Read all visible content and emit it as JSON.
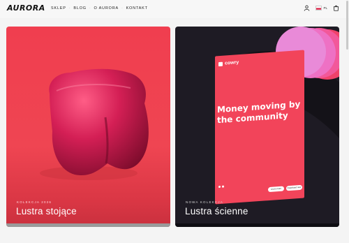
{
  "header": {
    "logo": "AURORA",
    "nav": [
      {
        "label": "SKLEP"
      },
      {
        "label": "BLOG"
      },
      {
        "label": "O AURORA"
      },
      {
        "label": "KONTAKT"
      }
    ],
    "language": "PL",
    "icons": [
      "user-icon",
      "flag-pl-icon",
      "cart-icon"
    ]
  },
  "cards": [
    {
      "tag": "KOLEKCJA 2026",
      "title": "Lustra stojące",
      "background": "#ef4552"
    },
    {
      "tag": "NOWA KOLEKCJA",
      "title": "Lustra ścienne",
      "background": "#1e1b24",
      "poster": {
        "brand": "cowry",
        "headline": "Money moving by the community",
        "buttons": [
          "Learn more",
          "Download now"
        ]
      }
    }
  ],
  "colors": {
    "accent_red": "#ef4552",
    "dark_card": "#1e1b24",
    "pink_disc": "#e98ad8"
  }
}
